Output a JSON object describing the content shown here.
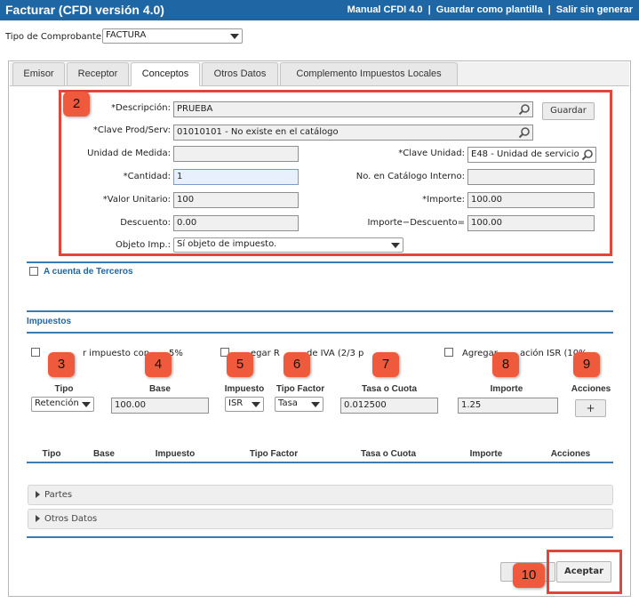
{
  "header": {
    "title": "Facturar (CFDI versión 4.0)",
    "links": [
      "Manual CFDI 4.0",
      "Guardar como plantilla",
      "Salir sin generar"
    ],
    "separator": "|"
  },
  "tipo_comprobante": {
    "label": "Tipo de Comprobante:",
    "value": "FACTURA"
  },
  "tabs": [
    "Emisor",
    "Receptor",
    "Conceptos",
    "Otros Datos",
    "Complemento Impuestos Locales"
  ],
  "concepto": {
    "descripcion": {
      "label": "*Descripción:",
      "value": "PRUEBA"
    },
    "guardar": "Guardar",
    "clave_prod": {
      "label": "*Clave Prod/Serv:",
      "value": "01010101 - No existe en el catálogo"
    },
    "unidad_medida": {
      "label": "Unidad de Medida:",
      "value": ""
    },
    "clave_unidad": {
      "label": "*Clave Unidad:",
      "value": "E48 - Unidad de servicio"
    },
    "cantidad": {
      "label": "*Cantidad:",
      "value": "1"
    },
    "no_catalogo": {
      "label": "No. en Catálogo Interno:",
      "value": ""
    },
    "valor_unitario": {
      "label": "*Valor Unitario:",
      "value": "100"
    },
    "importe": {
      "label": "*Importe:",
      "value": "100.00"
    },
    "descuento": {
      "label": "Descuento:",
      "value": "0.00"
    },
    "importe_descuento": {
      "label": "Importe−Descuento=",
      "value": "100.00"
    },
    "objeto_imp": {
      "label": "Objeto Imp.:",
      "value": "Sí objeto de impuesto."
    }
  },
  "terceros": {
    "label": "A cuenta de Terceros"
  },
  "impuestos": {
    "title": "Impuestos",
    "checks": [
      "r impuesto con",
      "5%",
      "egar R",
      "de IVA (2/3 p",
      "Agregar",
      "ación ISR (10%"
    ],
    "headers": [
      "Tipo",
      "Base",
      "Impuesto",
      "Tipo Factor",
      "Tasa o Cuota",
      "Importe",
      "Acciones"
    ],
    "row": {
      "tipo": "Retención",
      "base": "100.00",
      "impuesto": "ISR",
      "tipo_factor": "Tasa",
      "tasa": "0.012500",
      "importe": "1.25",
      "add": "+"
    },
    "table_headers": [
      "Tipo",
      "Base",
      "Impuesto",
      "Tipo Factor",
      "Tasa o Cuota",
      "Importe",
      "Acciones"
    ]
  },
  "accordions": [
    "Partes",
    "Otros Datos"
  ],
  "footer": {
    "aceptar": "Aceptar"
  },
  "badges": [
    "2",
    "3",
    "4",
    "5",
    "6",
    "7",
    "8",
    "9",
    "10"
  ],
  "colors": {
    "header_bg": "#1f66a5",
    "annotation": "#f05a3c",
    "annotation_border": "#e0463a",
    "section_line": "#3b7bb5"
  }
}
